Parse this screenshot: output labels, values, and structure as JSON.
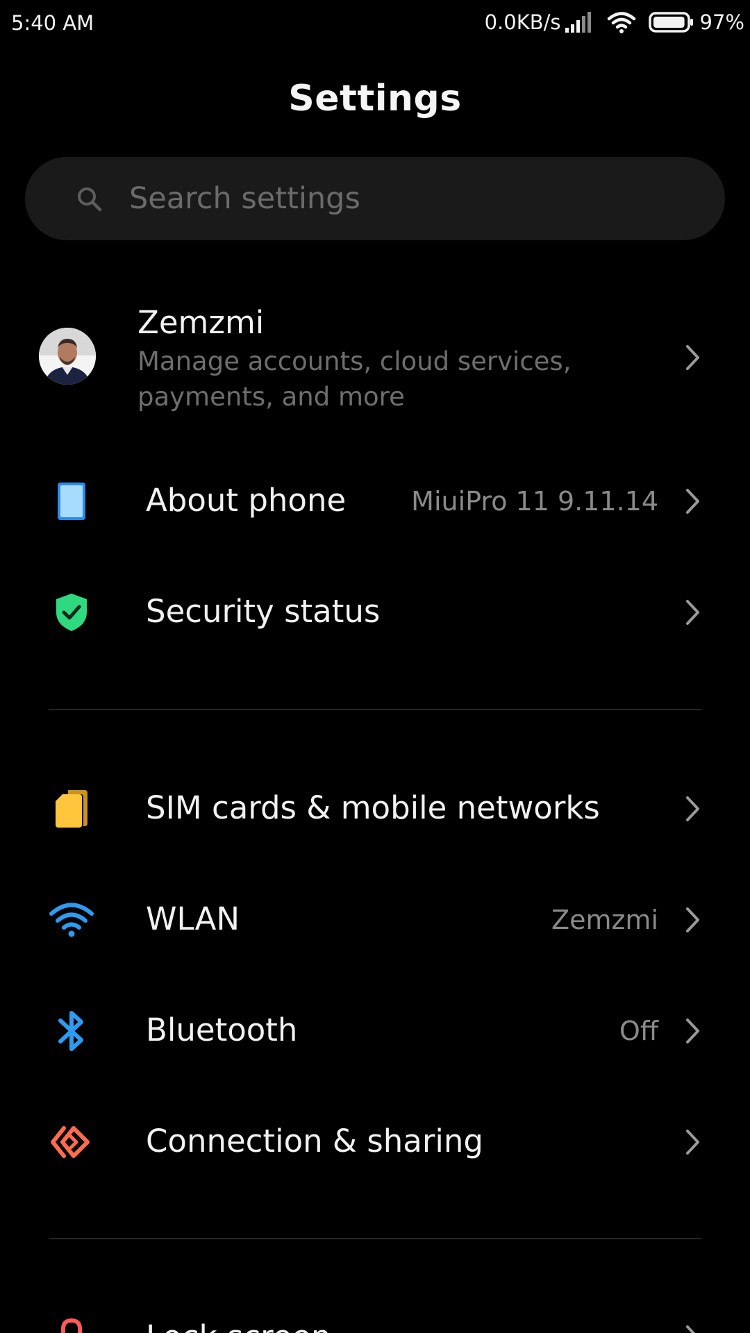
{
  "status_bar": {
    "time": "5:40 AM",
    "network_speed": "0.0KB/s",
    "battery_percent": "97%",
    "battery_level": 0.97
  },
  "header": {
    "title": "Settings"
  },
  "search": {
    "placeholder": "Search settings",
    "value": ""
  },
  "account": {
    "name": "Zemzmi",
    "description": "Manage accounts, cloud services, payments, and more"
  },
  "items": [
    {
      "label": "About phone",
      "value": "MiuiPro 11 9.11.14",
      "icon": "phone-icon",
      "color": "#9fd6ff"
    },
    {
      "label": "Security status",
      "value": "",
      "icon": "shield-check-icon",
      "color": "#2fd97f"
    },
    {
      "label": "SIM cards & mobile networks",
      "value": "",
      "icon": "sim-card-icon",
      "color": "#ffc53d"
    },
    {
      "label": "WLAN",
      "value": "Zemzmi",
      "icon": "wifi-icon",
      "color": "#2d9bf0"
    },
    {
      "label": "Bluetooth",
      "value": "Off",
      "icon": "bluetooth-icon",
      "color": "#2d9bf0"
    },
    {
      "label": "Connection & sharing",
      "value": "",
      "icon": "connection-sharing-icon",
      "color": "#ff6b4f"
    },
    {
      "label": "Lock screen",
      "value": "",
      "icon": "lock-icon",
      "color": "#ff5a5a"
    }
  ]
}
